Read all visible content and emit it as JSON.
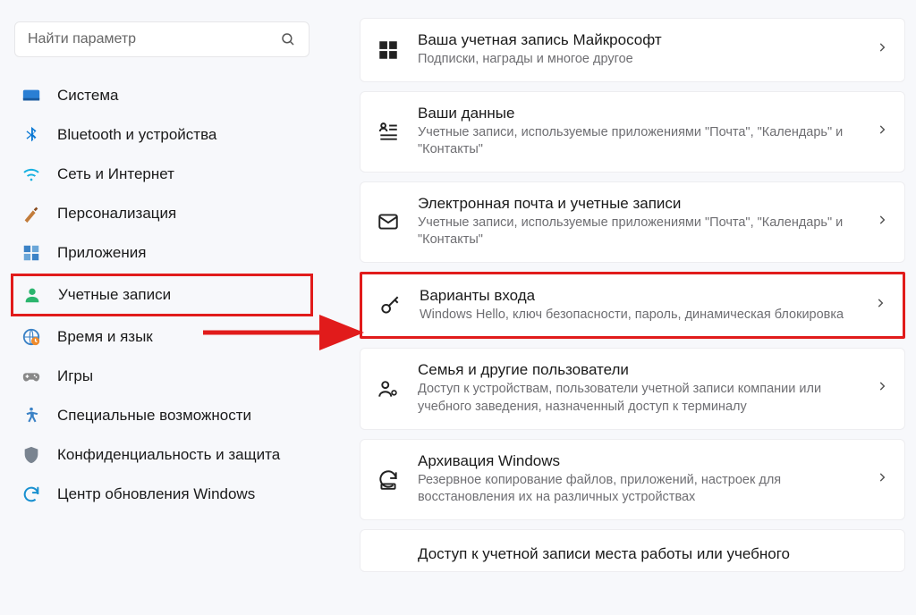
{
  "search": {
    "placeholder": "Найти параметр"
  },
  "sidebar": {
    "items": [
      {
        "label": "Система"
      },
      {
        "label": "Bluetooth и устройства"
      },
      {
        "label": "Сеть и Интернет"
      },
      {
        "label": "Персонализация"
      },
      {
        "label": "Приложения"
      },
      {
        "label": "Учетные записи"
      },
      {
        "label": "Время и язык"
      },
      {
        "label": "Игры"
      },
      {
        "label": "Специальные возможности"
      },
      {
        "label": "Конфиденциальность и защита"
      },
      {
        "label": "Центр обновления Windows"
      }
    ]
  },
  "cards": [
    {
      "title": "Ваша учетная запись Майкрософт",
      "desc": "Подписки, награды и многое другое"
    },
    {
      "title": "Ваши данные",
      "desc": "Учетные записи, используемые приложениями \"Почта\", \"Календарь\" и \"Контакты\""
    },
    {
      "title": "Электронная почта и учетные записи",
      "desc": "Учетные записи, используемые приложениями \"Почта\", \"Календарь\" и \"Контакты\""
    },
    {
      "title": "Варианты входа",
      "desc": "Windows Hello, ключ безопасности, пароль, динамическая блокировка"
    },
    {
      "title": "Семья и другие пользователи",
      "desc": "Доступ к устройствам, пользователи учетной записи компании или учебного заведения, назначенный доступ к терминалу"
    },
    {
      "title": "Архивация Windows",
      "desc": "Резервное копирование файлов, приложений, настроек для восстановления их на различных устройствах"
    },
    {
      "title": "Доступ к учетной записи места работы или учебного",
      "desc": ""
    }
  ]
}
